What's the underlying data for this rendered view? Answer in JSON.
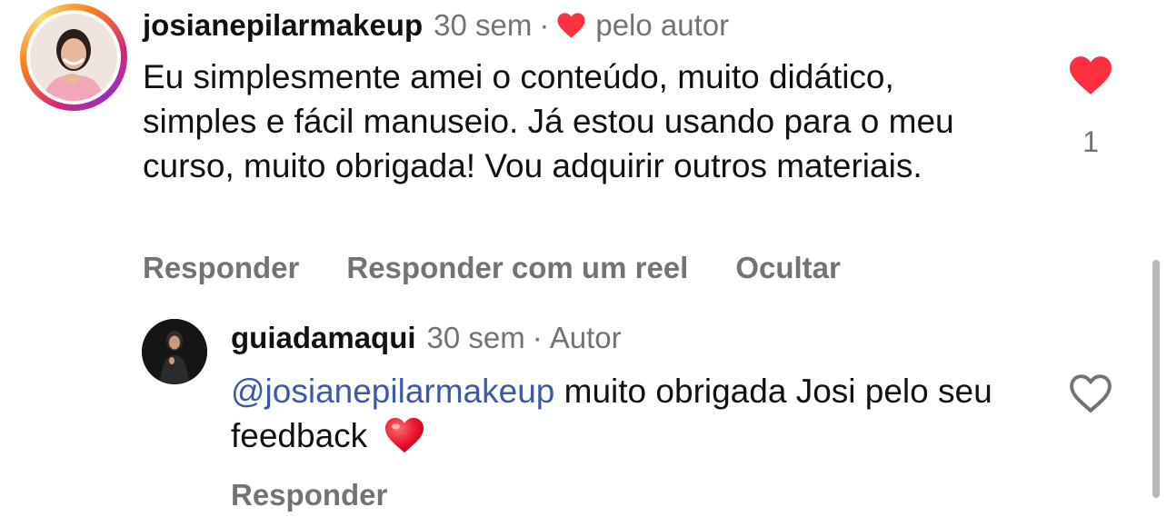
{
  "comment": {
    "username": "josianepilarmakeup",
    "time": "30 sem",
    "separator": "·",
    "liked_by_author": "pelo autor",
    "text": "Eu simplesmente amei o conteúdo, muito didático, simples e fácil manuseio. Já estou usando para o meu curso, muito obrigada! Vou adquirir outros materiais.",
    "like_count": "1",
    "actions": {
      "reply": "Responder",
      "reply_reel": "Responder com um reel",
      "hide": "Ocultar"
    }
  },
  "reply": {
    "username": "guiadamaqui",
    "time": "30 sem",
    "separator": "·",
    "role": "Autor",
    "mention": "@josianepilarmakeup",
    "text": " muito obrigada Josi pelo seu feedback",
    "actions": {
      "reply": "Responder"
    }
  },
  "colors": {
    "like_red": "#ff3040",
    "muted_text": "#737373",
    "mention_blue": "#3d5aa9"
  },
  "icons": {
    "liked": "heart-filled-icon",
    "like": "heart-outline-icon",
    "author_heart": "heart-small-icon",
    "emoji": "red-heart-emoji"
  }
}
